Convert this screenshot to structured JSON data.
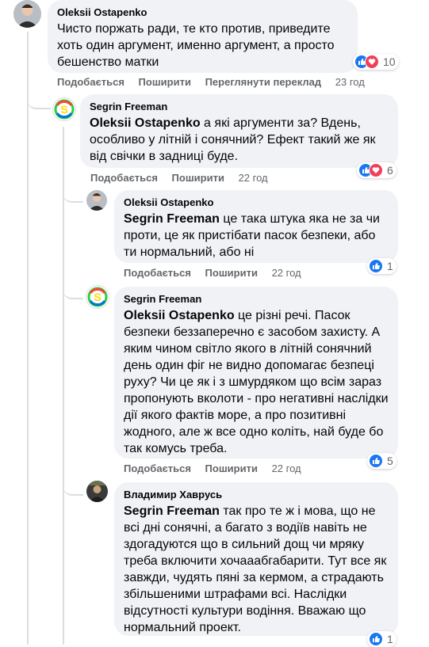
{
  "actions": {
    "like": "Подобається",
    "share": "Поширити",
    "translate": "Переглянути переклад"
  },
  "comments": [
    {
      "author": "Oleksii Ostapenko",
      "mention": "",
      "text": "Чисто поржать ради, те кто против, приведите хоть один аргумент, именно аргумент, а просто бешенство матки",
      "time": "23 год",
      "reactions": "10"
    },
    {
      "author": "Segrin Freeman",
      "mention": "Oleksii Ostapenko",
      "text": " а які аргументи за? Вдень, особливо у літній і сонячний? Ефект такий же як від свічки в задниці буде.",
      "time": "22 год",
      "reactions": "6"
    },
    {
      "author": "Oleksii Ostapenko",
      "mention": "Segrin Freeman",
      "text": " це така штука яка не за чи проти, це як пристібати пасок безпеки, або ти нормальний, або ні",
      "time": "22 год",
      "reactions": "1"
    },
    {
      "author": "Segrin Freeman",
      "mention": "Oleksii Ostapenko",
      "text": " це різні речі. Пасок безпеки беззаперечно є засобом захисту. А яким чином світло якого в літній сонячний день один фіг не видно допомагає безпеці руху? Чи це як і з шмурдяком що всім зараз пропонують вколоти - про негативні наслідки дії якого фактів море, а про позитивні жодного, але ж все одно коліть, най буде бо так комусь треба.",
      "time": "22 год",
      "reactions": "5"
    },
    {
      "author": "Владимир Хаврусь",
      "mention": "Segrin Freeman",
      "text": " так про те ж і мова, що не всі дні сонячні, а багато з водіїв навіть не здогадуются що в сильний дощ чи мряку треба включити хочааабгабарити. Тут все як завжди, чудять пяні за кермом, а страдають збільшеними штрафами всі. Наслідки відсутності культури водіння. Вважаю що нормальний проект.",
      "time": "",
      "reactions": "1"
    }
  ],
  "colors": {
    "like": "#1877f2",
    "love": "#f33e58",
    "bubble": "#f0f2f5",
    "meta": "#65676b"
  }
}
